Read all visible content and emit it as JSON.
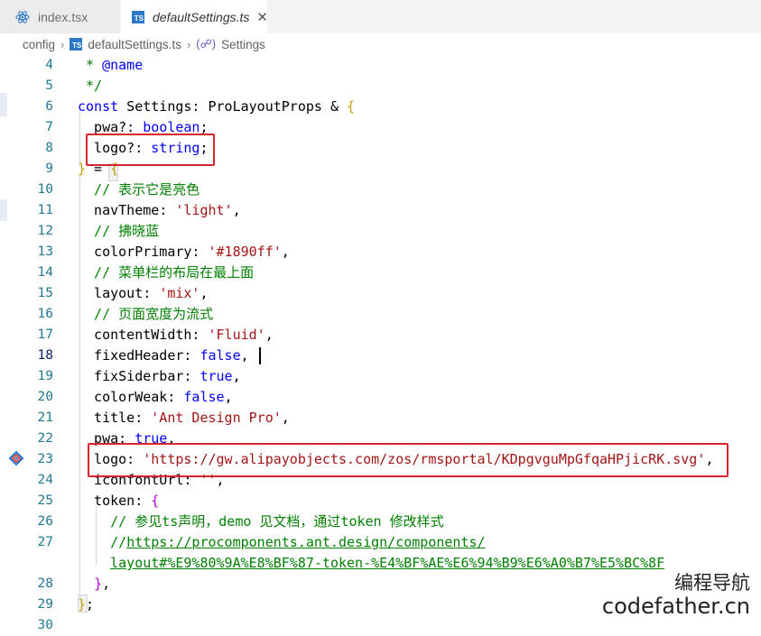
{
  "tabs": [
    {
      "label": "index.tsx",
      "icon": "react-icon",
      "active": false
    },
    {
      "label": "defaultSettings.ts",
      "icon": "ts-file-icon",
      "active": true
    }
  ],
  "ts_badge": "TS",
  "close_glyph": "✕",
  "breadcrumb": {
    "folder": "config",
    "file": "defaultSettings.ts",
    "symbol": "Settings"
  },
  "lines": [
    {
      "n": "4",
      "code": " * @name"
    },
    {
      "n": "5",
      "code": " */"
    },
    {
      "n": "6",
      "code": "const Settings: ProLayoutProps & {"
    },
    {
      "n": "7",
      "code": "  pwa?: boolean;"
    },
    {
      "n": "8",
      "code": "  logo?: string;"
    },
    {
      "n": "9",
      "code": "} = {"
    },
    {
      "n": "10",
      "code": "  // 表示它是亮色"
    },
    {
      "n": "11",
      "code": "  navTheme: 'light',"
    },
    {
      "n": "12",
      "code": "  // 拂晓蓝"
    },
    {
      "n": "13",
      "code": "  colorPrimary: '#1890ff',"
    },
    {
      "n": "14",
      "code": "  // 菜单栏的布局在最上面"
    },
    {
      "n": "15",
      "code": "  layout: 'mix',"
    },
    {
      "n": "16",
      "code": "  // 页面宽度为流式"
    },
    {
      "n": "17",
      "code": "  contentWidth: 'Fluid',"
    },
    {
      "n": "18",
      "code": "  fixedHeader: false,"
    },
    {
      "n": "19",
      "code": "  fixSiderbar: true,"
    },
    {
      "n": "20",
      "code": "  colorWeak: false,"
    },
    {
      "n": "21",
      "code": "  title: 'Ant Design Pro',"
    },
    {
      "n": "22",
      "code": "  pwa: true,"
    },
    {
      "n": "23",
      "code": "  logo: 'https://gw.alipayobjects.com/zos/rmsportal/KDpgvguMpGfqaHPjicRK.svg',"
    },
    {
      "n": "24",
      "code": "  iconfontUrl: '',"
    },
    {
      "n": "25",
      "code": "  token: {"
    },
    {
      "n": "26",
      "code": "    // 参见ts声明，demo 见文档，通过token 修改样式"
    },
    {
      "n": "27",
      "code": "    //https://procomponents.ant.design/components/"
    },
    {
      "n": "",
      "code": "    layout#%E9%80%9A%E8%BF%87-token-%E4%BF%AE%E6%94%B9%E6%A0%B7%E5%BC%8F"
    },
    {
      "n": "28",
      "code": "  },"
    },
    {
      "n": "29",
      "code": "};"
    },
    {
      "n": "30",
      "code": ""
    }
  ],
  "current_line": "18",
  "highlight_lines": [
    "8",
    "23"
  ],
  "colors": {
    "keyword": "#0000ff",
    "string": "#a31515",
    "comment": "#008000",
    "type": "#267f99",
    "linenumber": "#237893",
    "highlight_box": "#d6262c"
  },
  "watermark": {
    "line1": "编程导航",
    "line2": "codefather.cn"
  }
}
